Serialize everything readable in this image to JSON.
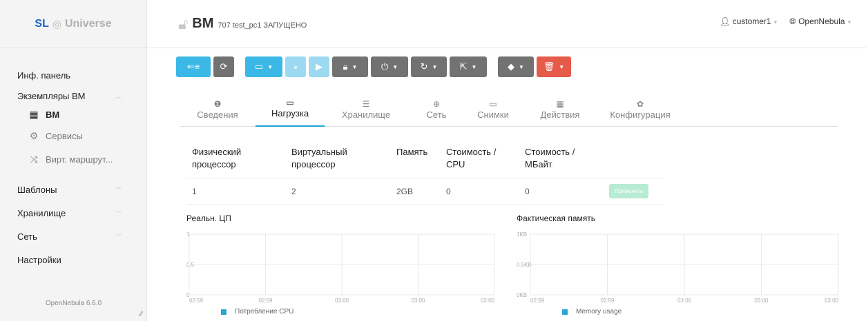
{
  "sidebar": {
    "logo_sl": "SL",
    "logo_universe": "Universe",
    "nav": [
      {
        "label": "Инф. панель"
      },
      {
        "label": "Экземпляры ВМ"
      },
      {
        "label": "ВМ"
      },
      {
        "label": "Сервисы"
      },
      {
        "label": "Вирт. маршрут..."
      },
      {
        "label": "Шаблоны"
      },
      {
        "label": "Хранилище"
      },
      {
        "label": "Сеть"
      },
      {
        "label": "Настройки"
      }
    ],
    "version": "OpenNebula 6.6.0"
  },
  "header": {
    "title": "ВМ",
    "subtitle": "707 test_pc1 ЗАПУЩЕНО",
    "user": "customer1",
    "zone": "OpenNebula"
  },
  "tabs": [
    {
      "label": "Сведения",
      "icon": "info-icon"
    },
    {
      "label": "Нагрузка",
      "icon": "laptop-icon"
    },
    {
      "label": "Хранилище",
      "icon": "storage-icon"
    },
    {
      "label": "Сеть",
      "icon": "globe-icon"
    },
    {
      "label": "Снимки",
      "icon": "laptop-icon"
    },
    {
      "label": "Действия",
      "icon": "calendar-icon"
    },
    {
      "label": "Конфигурация",
      "icon": "gear-icon"
    }
  ],
  "capacity": {
    "headers": [
      "Физический процессор",
      "Виртуальный процессор",
      "Память",
      "Стоимость / CPU",
      "Стоимость / МБайт"
    ],
    "values": [
      "1",
      "2",
      "2GB",
      "0",
      "0"
    ],
    "apply_label": "Применить"
  },
  "chart_data": [
    {
      "type": "line",
      "title": "Реальн. ЦП",
      "x": [
        "02:59",
        "02:59",
        "03:00",
        "03:00",
        "03:00"
      ],
      "ylim": [
        0,
        1
      ],
      "yticks": [
        "0",
        "0.5",
        "1"
      ],
      "series": [
        {
          "name": "Потребление CPU",
          "values": []
        }
      ],
      "grid": true,
      "legend": "bottom",
      "color": "#2aa6d6"
    },
    {
      "type": "line",
      "title": "Фактическая память",
      "x": [
        "02:59",
        "02:59",
        "03:00",
        "03:00",
        "03:00"
      ],
      "ylim": [
        0,
        1
      ],
      "yticks": [
        "0KB",
        "0.5KB",
        "1KB"
      ],
      "series": [
        {
          "name": "Memory usage",
          "values": []
        }
      ],
      "grid": true,
      "legend": "bottom",
      "color": "#2aa6d6"
    }
  ]
}
